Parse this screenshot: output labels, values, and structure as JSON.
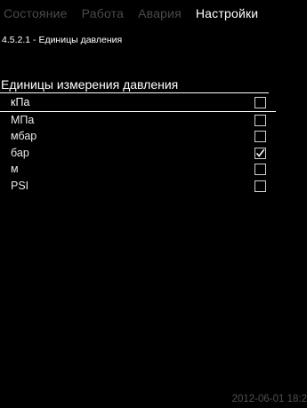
{
  "tabs": [
    {
      "label": "Состояние",
      "active": false
    },
    {
      "label": "Работа",
      "active": false
    },
    {
      "label": "Авария",
      "active": false
    },
    {
      "label": "Настройки",
      "active": true
    }
  ],
  "breadcrumb": "4.5.2.1 - Единицы давления",
  "section_title": "Единицы измерения давления",
  "options": [
    {
      "label": "кПа",
      "checked": false,
      "selected": true
    },
    {
      "label": "МПа",
      "checked": false,
      "selected": false
    },
    {
      "label": "мбар",
      "checked": false,
      "selected": false
    },
    {
      "label": "бар",
      "checked": true,
      "selected": false
    },
    {
      "label": "м",
      "checked": false,
      "selected": false
    },
    {
      "label": "PSI",
      "checked": false,
      "selected": false
    }
  ],
  "timestamp": "2012-06-01 18:2"
}
